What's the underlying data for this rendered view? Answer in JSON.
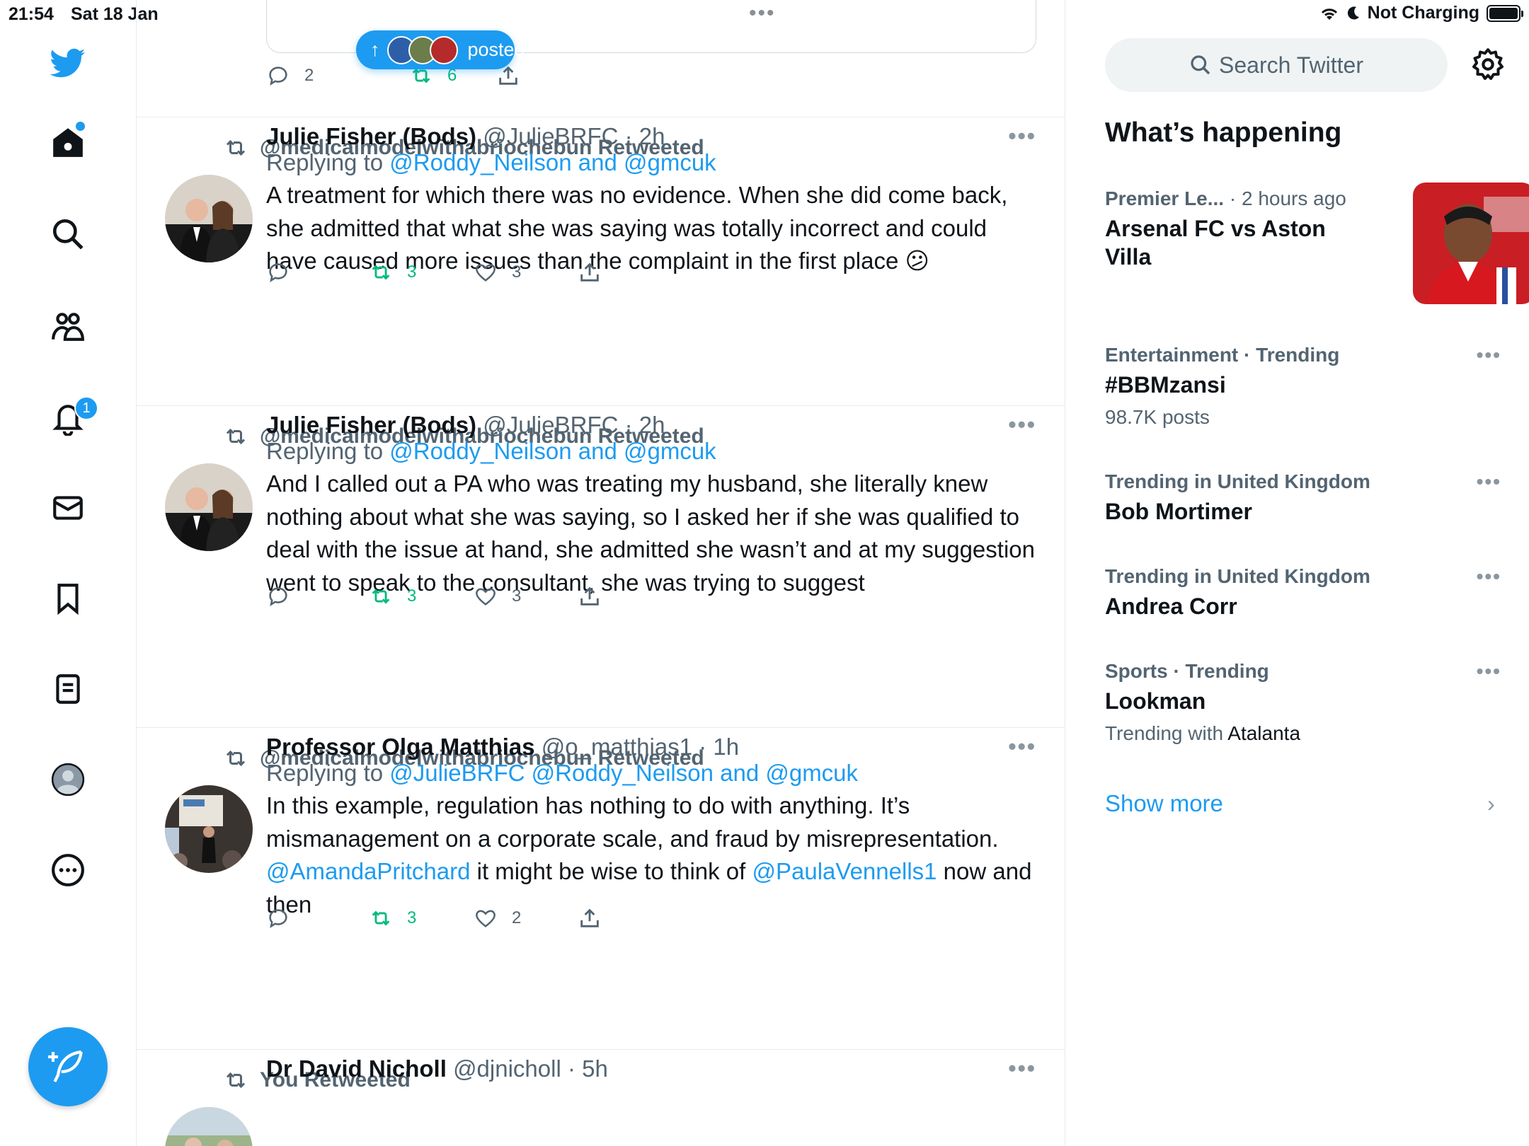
{
  "status_bar": {
    "time": "21:54",
    "date": "Sat 18 Jan",
    "charging": "Not Charging"
  },
  "nav": {
    "items": [
      {
        "name": "twitter-logo",
        "icon": "bird-icon"
      },
      {
        "name": "home",
        "icon": "home-icon"
      },
      {
        "name": "explore",
        "icon": "search-icon"
      },
      {
        "name": "communities",
        "icon": "communities-icon"
      },
      {
        "name": "notifications",
        "icon": "bell-icon",
        "badge": "1"
      },
      {
        "name": "messages",
        "icon": "envelope-icon"
      },
      {
        "name": "bookmarks",
        "icon": "bookmark-icon"
      },
      {
        "name": "lists",
        "icon": "list-icon"
      },
      {
        "name": "profile",
        "icon": "avatar-icon"
      },
      {
        "name": "more",
        "icon": "more-circle-icon"
      }
    ],
    "compose_icon": "compose-feather-icon"
  },
  "posted_pill": {
    "label": "posted",
    "arrow": "↑"
  },
  "top_actions": {
    "replies": "2",
    "retweets": "6"
  },
  "tweets": [
    {
      "retweeted_by": "@medicalmodelwithabriochebun Retweeted",
      "name": "Julie Fisher (Bods)",
      "handle": "@JulieBRFC",
      "time": "2h",
      "replying_label": "Replying to",
      "replying_links": "@Roddy_Neilson and @gmcuk",
      "body": "A treatment for which there was no evidence. When she did come back, she admitted that what she was saying was totally incorrect and could have caused more issues than the complaint in the first place 😕",
      "retweets": "3",
      "likes": "3"
    },
    {
      "retweeted_by": "@medicalmodelwithabriochebun Retweeted",
      "name": "Julie Fisher (Bods)",
      "handle": "@JulieBRFC",
      "time": "2h",
      "replying_label": "Replying to",
      "replying_links": "@Roddy_Neilson and @gmcuk",
      "body": "And I called out a PA who was treating my husband, she literally knew nothing about what she was saying, so I asked her if she was qualified to deal with the issue at hand, she admitted she wasn’t and at my suggestion went to speak to the consultant, she was trying to suggest",
      "retweets": "3",
      "likes": "3"
    },
    {
      "retweeted_by": "@medicalmodelwithabriochebun Retweeted",
      "name": "Professor Olga Matthias",
      "handle": "@o_matthias1",
      "time": "1h",
      "replying_label": "Replying to",
      "replying_links": "@JulieBRFC @Roddy_Neilson and @gmcuk",
      "body_pre": "In this example, regulation has nothing to do with anything.  It’s mismanagement on a corporate scale, and fraud by misrepresentation. ",
      "mention1": "@AmandaPritchard",
      "body_mid": " it might be wise to think of ",
      "mention2": "@PaulaVennells1",
      "body_post": " now and then",
      "retweets": "3",
      "likes": "2"
    },
    {
      "retweeted_by": "You Retweeted",
      "name": "Dr David Nicholl",
      "handle": "@djnicholl",
      "time": "5h"
    }
  ],
  "sidebar": {
    "search_placeholder": "Search Twitter",
    "section_title": "What’s happening",
    "trends": [
      {
        "category": "Premier Le...",
        "meta_suffix": " · 2 hours ago",
        "title": "Arsenal FC vs Aston Villa"
      },
      {
        "category": "Entertainment · Trending",
        "title": "#BBMzansi",
        "sub": "98.7K posts"
      },
      {
        "category": "Trending in United Kingdom",
        "title": "Bob Mortimer"
      },
      {
        "category": "Trending in United Kingdom",
        "title": "Andrea Corr"
      },
      {
        "category": "Sports · Trending",
        "title": "Lookman",
        "sub_prefix": "Trending with ",
        "sub_entity": "Atalanta"
      }
    ],
    "show_more": "Show more"
  },
  "colors": {
    "accent": "#1d9bf0",
    "retweet_green": "#00ba7c",
    "secondary_text": "#536471"
  }
}
